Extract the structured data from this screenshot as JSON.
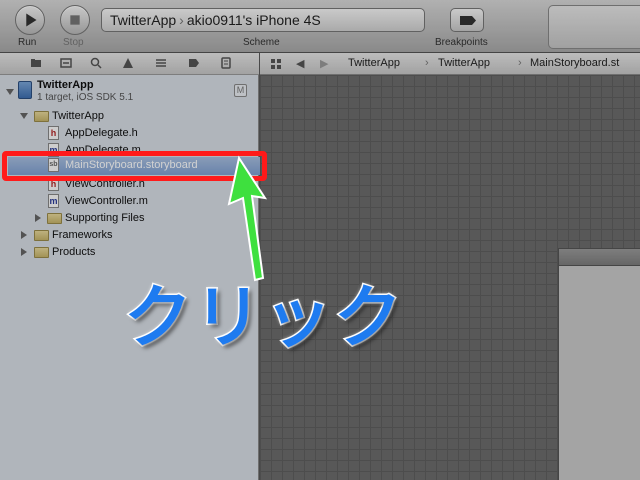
{
  "toolbar": {
    "run_label": "Run",
    "stop_label": "Stop",
    "scheme_label": "Scheme",
    "breakpoints_label": "Breakpoints",
    "scheme_target": "TwitterApp",
    "scheme_device": "akio0911's iPhone 4S"
  },
  "navigator": {
    "project_name": "TwitterApp",
    "project_subtitle": "1 target, iOS SDK 5.1",
    "scm_badge": "M",
    "items": [
      {
        "label": "TwitterApp",
        "kind": "group"
      },
      {
        "label": "AppDelegate.h",
        "kind": "h"
      },
      {
        "label": "AppDelegate.m",
        "kind": "m"
      },
      {
        "label": "MainStoryboard.storyboard",
        "kind": "storyboard"
      },
      {
        "label": "ViewController.h",
        "kind": "h"
      },
      {
        "label": "ViewController.m",
        "kind": "m"
      },
      {
        "label": "Supporting Files",
        "kind": "group"
      },
      {
        "label": "Frameworks",
        "kind": "group"
      },
      {
        "label": "Products",
        "kind": "group"
      }
    ],
    "file_badges": {
      "h": "h",
      "m": "m",
      "storyboard": "sb"
    }
  },
  "jump_bar": {
    "crumbs": [
      "TwitterApp",
      "TwitterApp",
      "MainStoryboard.st"
    ]
  },
  "annotation": {
    "text": "クリック",
    "text_color": "#1e7bf0",
    "arrow_color": "#3ee03e",
    "box_color": "#ff1a1a"
  }
}
